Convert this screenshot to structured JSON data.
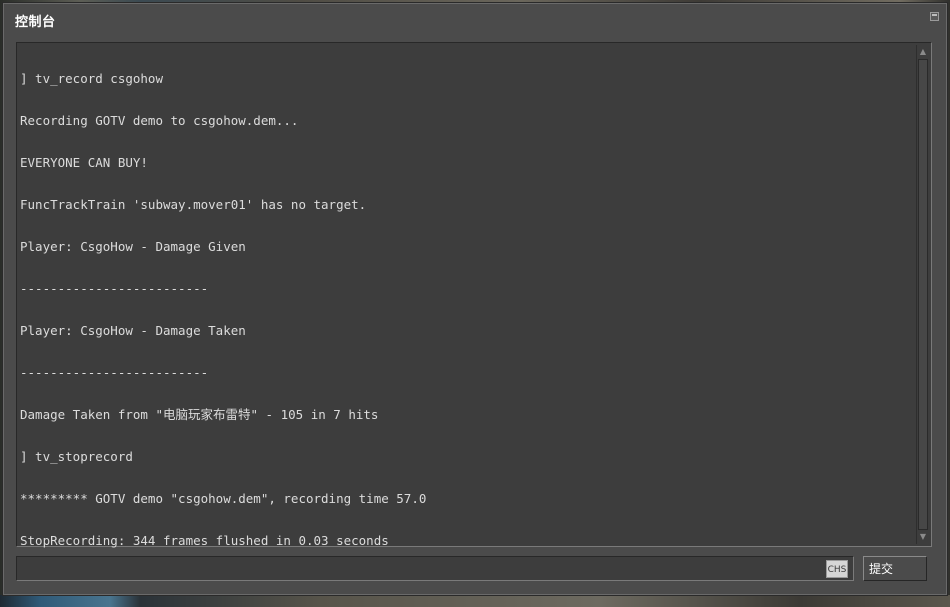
{
  "window": {
    "title": "控制台"
  },
  "console": {
    "lines": [
      "] tv_record csgohow",
      "Recording GOTV demo to csgohow.dem...",
      "EVERYONE CAN BUY!",
      "FuncTrackTrain 'subway.mover01' has no target.",
      "Player: CsgoHow - Damage Given",
      "-------------------------",
      "Player: CsgoHow - Damage Taken",
      "-------------------------",
      "Damage Taken from \"电脑玩家布雷特\" - 105 in 7 hits",
      "] tv_stoprecord",
      "********* GOTV demo \"csgohow.dem\", recording time 57.0",
      "StopRecording: 344 frames flushed in 0.03 seconds"
    ]
  },
  "input": {
    "value": "",
    "ime_label": "CHS"
  },
  "submit": {
    "label": "提交"
  },
  "icons": {
    "title_button": "window-restore-icon",
    "scroll_up": "scroll-up-arrow-icon",
    "scroll_down": "scroll-down-arrow-icon"
  },
  "colors": {
    "window_bg": "#4b4b4b",
    "panel_bg": "#3d3d3d",
    "text": "#dcdcdc",
    "title_text": "#ffffff"
  }
}
